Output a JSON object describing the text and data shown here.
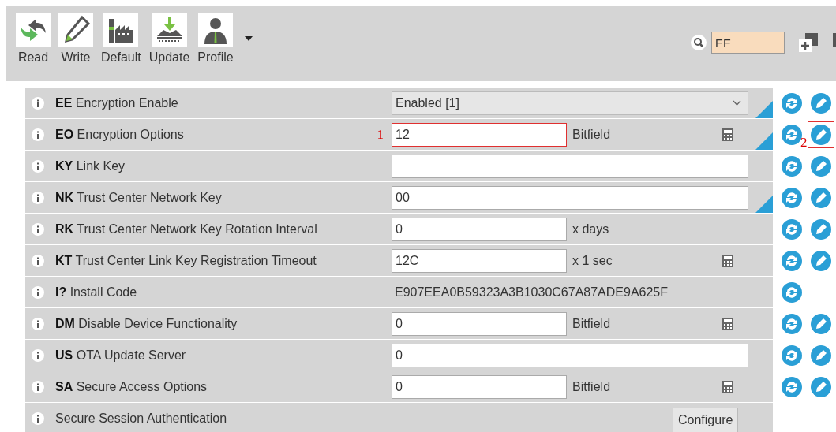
{
  "toolbar": {
    "buttons": [
      {
        "label": "Read",
        "menu": false
      },
      {
        "label": "Write",
        "menu": false
      },
      {
        "label": "Default",
        "menu": false
      },
      {
        "label": "Update",
        "menu": false
      },
      {
        "label": "Profile",
        "menu": true
      }
    ],
    "search": {
      "value": "EE"
    }
  },
  "rows": [
    {
      "label": "**EE** Encryption Enable",
      "kind": "dropdown",
      "value": "Enabled [1]",
      "modified": true,
      "writable": true
    },
    {
      "label": "**EO** Encryption Options",
      "kind": "short",
      "value": "12",
      "unit": "Bitfield",
      "calculator": true,
      "modified": true,
      "writable": true,
      "marker": "1",
      "write_marker": "2"
    },
    {
      "label": "**KY** Link Key",
      "kind": "wide",
      "value": "",
      "modified": false,
      "writable": true
    },
    {
      "label": "**NK** Trust Center Network Key",
      "kind": "wide",
      "value": "00",
      "modified": true,
      "writable": true
    },
    {
      "label": "**RK** Trust Center Network Key Rotation Interval",
      "kind": "short",
      "value": "0",
      "unit": "x days",
      "calculator": false,
      "modified": false,
      "writable": true
    },
    {
      "label": "**KT** Trust Center Link Key Registration Timeout",
      "kind": "short",
      "value": "12C",
      "unit": "x 1 sec",
      "calculator": true,
      "modified": false,
      "writable": true
    },
    {
      "label": "**I?** Install Code",
      "kind": "readonly",
      "value": "E907EEA0B59323A3B1030C67A87ADE9A625F",
      "modified": false,
      "writable": false
    },
    {
      "label": "**DM** Disable Device Functionality",
      "kind": "short",
      "value": "0",
      "unit": "Bitfield",
      "calculator": true,
      "modified": false,
      "writable": true
    },
    {
      "label": "**US** OTA Update Server",
      "kind": "wide",
      "value": "0",
      "modified": false,
      "writable": true
    },
    {
      "label": "**SA** Secure Access Options",
      "kind": "short",
      "value": "0",
      "unit": "Bitfield",
      "calculator": true,
      "modified": false,
      "writable": true
    },
    {
      "label": "Secure Session Authentication",
      "kind": "button",
      "value": "Configure",
      "modified": false,
      "writable": false,
      "readable": false
    }
  ]
}
